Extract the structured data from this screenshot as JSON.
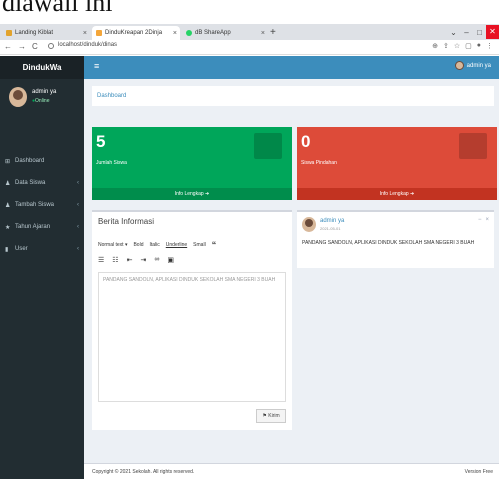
{
  "caption": "diawali ini",
  "browser": {
    "tabs": [
      {
        "label": "Landing Kiblat"
      },
      {
        "label": "DinduKreapan 2Dinja"
      },
      {
        "label": "dB ShareApp"
      }
    ],
    "url": "localhost/dinduk/dinas"
  },
  "app": {
    "logo": "DindukWa",
    "user": {
      "name": "admin ya",
      "status": "Online"
    },
    "menu": [
      {
        "label": "Dashboard",
        "icon": "dashboard-icon",
        "has_arrow": false
      },
      {
        "label": "Data Siswa",
        "icon": "user-icon",
        "has_arrow": true
      },
      {
        "label": "Tambah Siswa",
        "icon": "user-plus-icon",
        "has_arrow": true
      },
      {
        "label": "Tahun Ajaran",
        "icon": "star-icon",
        "has_arrow": true
      },
      {
        "label": "User",
        "icon": "book-icon",
        "has_arrow": true
      }
    ],
    "topnav_user": "admin ya"
  },
  "breadcrumb": "Dashboard",
  "stats": [
    {
      "number": "5",
      "label": "Jumlah Siswa",
      "footer": "Info Lengkap",
      "color": "#00a65a"
    },
    {
      "number": "0",
      "label": "Siswa Pindahan",
      "footer": "Info Lengkap",
      "color": "#dd4b39"
    }
  ],
  "editor": {
    "title": "Berita Informasi",
    "toolbar": [
      "Normal text",
      "Bold",
      "Italic",
      "Underline",
      "Small"
    ],
    "placeholder_text": "PANDANG SANDOLN, APLIKASI DINDUK SEKOLAH SMA NEGERI 3 BUAH",
    "send": "Kirim"
  },
  "post": {
    "user": "admin ya",
    "date": "2021-05-01",
    "text": "PANDANG SANDOLN, APLIKASI DINDUK SEKOLAH SMA NEGERI 3 BUAH"
  },
  "footer": {
    "copyright": "Copyright © 2021 Sekolah. All rights reserved.",
    "version": "Version Free"
  }
}
